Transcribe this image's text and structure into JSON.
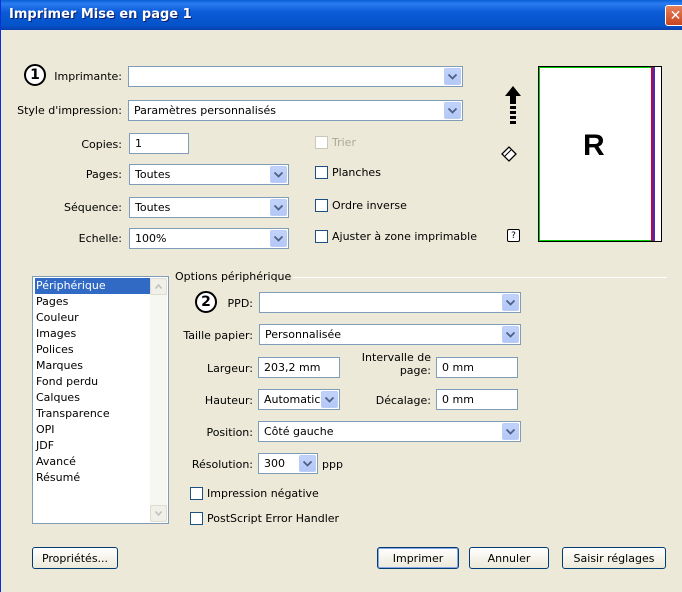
{
  "window": {
    "title": "Imprimer Mise en page 1",
    "close": "✕"
  },
  "markers": {
    "one": "1",
    "two": "2"
  },
  "top": {
    "printer_label": "Imprimante:",
    "printer_value": "",
    "style_label": "Style d'impression:",
    "style_value": "Paramètres personnalisés",
    "copies_label": "Copies:",
    "copies_value": "1",
    "collate_label": "Trier",
    "pages_label": "Pages:",
    "pages_value": "Toutes",
    "spreads_label": "Planches",
    "sequence_label": "Séquence:",
    "sequence_value": "Toutes",
    "reverse_label": "Ordre inverse",
    "scale_label": "Echelle:",
    "scale_value": "100%",
    "fit_label": "Ajuster à zone imprimable",
    "help": "?"
  },
  "preview": {
    "letter": "R"
  },
  "sidebar": {
    "items": [
      "Périphérique",
      "Pages",
      "Couleur",
      "Images",
      "Polices",
      "Marques",
      "Fond perdu",
      "Calques",
      "Transparence",
      "OPI",
      "JDF",
      "Avancé",
      "Résumé"
    ],
    "selected": 0
  },
  "device_options": {
    "group_title": "Options périphérique",
    "ppd_label": "PPD:",
    "ppd_value": "",
    "paper_size_label": "Taille papier:",
    "paper_size_value": "Personnalisée",
    "width_label": "Largeur:",
    "width_value": "203,2 mm",
    "gap_label_line1": "Intervalle de",
    "gap_label_line2": "page:",
    "gap_value": "0 mm",
    "height_label": "Hauteur:",
    "height_value": "Automatic",
    "offset_label": "Décalage:",
    "offset_value": "0 mm",
    "position_label": "Position:",
    "position_value": "Côté gauche",
    "resolution_label": "Résolution:",
    "resolution_value": "300",
    "resolution_unit": "ppp",
    "negative_label": "Impression négative",
    "ps_error_label": "PostScript Error Handler"
  },
  "buttons": {
    "properties": "Propriétés...",
    "print": "Imprimer",
    "cancel": "Annuler",
    "save": "Saisir réglages"
  },
  "icons": {
    "close": "close-icon",
    "dropdown": "chevron-down-icon",
    "orientation": "orientation-arrow-icon",
    "rotate": "page-rotate-icon",
    "help": "help-icon"
  },
  "colors": {
    "titlebar": "#0a5fd6",
    "window": "#ece9d8",
    "selection": "#316ac5",
    "preview_left": "#00cc00",
    "preview_right_a": "#cc0033",
    "preview_right_b": "#3333cc"
  }
}
